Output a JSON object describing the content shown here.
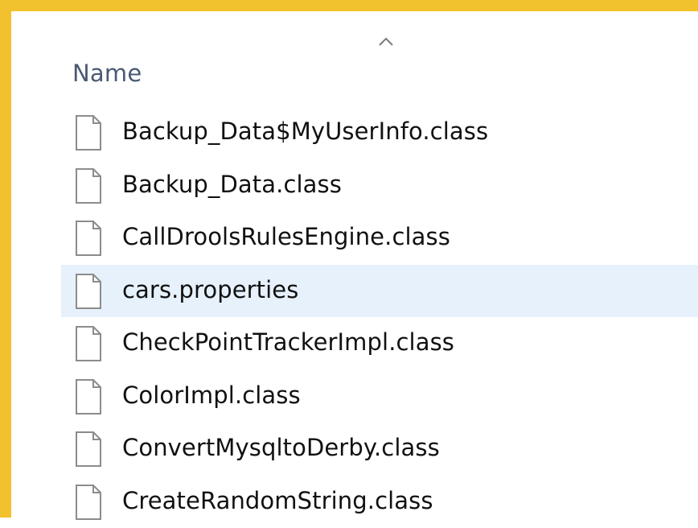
{
  "header": {
    "column_label": "Name",
    "sort_indicator_icon": "chevron-up-icon"
  },
  "files": [
    {
      "name": "Backup_Data$MyUserInfo.class",
      "icon": "file-icon",
      "selected": false
    },
    {
      "name": "Backup_Data.class",
      "icon": "file-icon",
      "selected": false
    },
    {
      "name": "CallDroolsRulesEngine.class",
      "icon": "file-icon",
      "selected": false
    },
    {
      "name": "cars.properties",
      "icon": "file-icon",
      "selected": true
    },
    {
      "name": "CheckPointTrackerImpl.class",
      "icon": "file-icon",
      "selected": false
    },
    {
      "name": "ColorImpl.class",
      "icon": "file-icon",
      "selected": false
    },
    {
      "name": "ConvertMysqltoDerby.class",
      "icon": "file-icon",
      "selected": false
    },
    {
      "name": "CreateRandomString.class",
      "icon": "file-icon",
      "selected": false
    }
  ],
  "colors": {
    "border_highlight": "#f2c12e",
    "selected_row": "#e6f1fb",
    "header_text": "#4a5a75"
  }
}
